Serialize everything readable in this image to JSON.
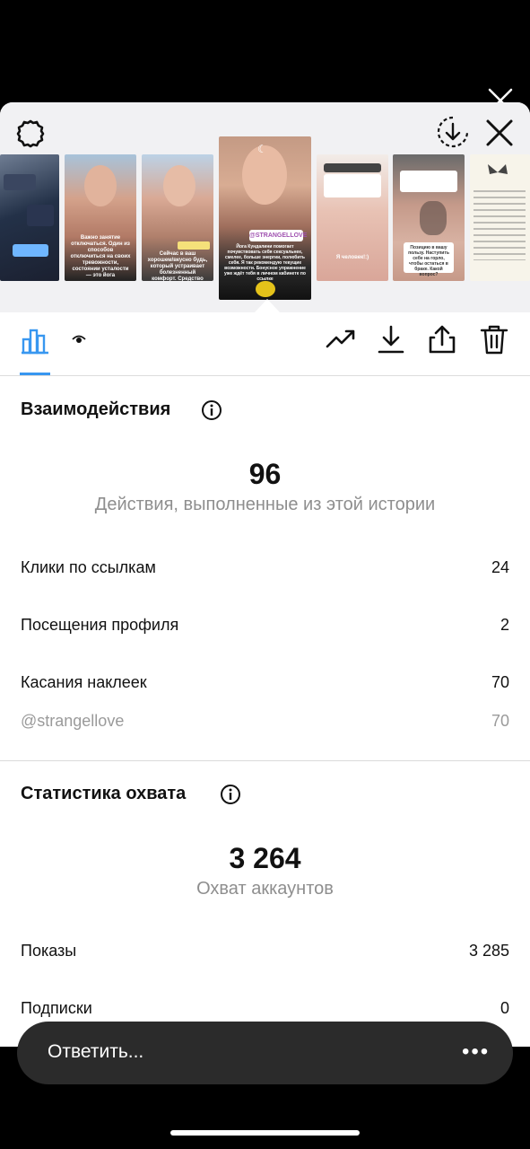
{
  "toolbar": {
    "tabs": [
      {
        "icon": "bar-chart-icon",
        "active": true
      },
      {
        "icon": "eye-icon",
        "active": false
      }
    ],
    "actions": [
      "trending-icon",
      "download-icon",
      "share-icon",
      "trash-icon"
    ],
    "accent": "#3897f0"
  },
  "stories_strip": {
    "thumbs": [
      {
        "caption": ""
      },
      {
        "caption": "Важно занятие отключаться. Один из способов отключиться на своих тревожности, состоянии усталости — это йога"
      },
      {
        "caption": "Сейчас в ваш хорошем/вкусно будь, который устраивает болезненный комфорт. Средство кружение для природы. Кроме Я давно болезни"
      },
      {
        "caption": "Йога Кундалини помогает почувствовать себя сексуальнее, смелее, больше энергии, полюбить себя. Я так рекомендую текущие возможности. Бонусное упражнение уже ждёт тебя в личном кабинете по ссылке",
        "sticker": "@STRANGELLOVE",
        "selected": true
      },
      {
        "caption": "Я человек!:)"
      },
      {
        "caption": "Позицию в вашу пользу. Наступить себе на горло, чтобы остаться в браке. Какой вопрос?"
      },
      {
        "caption": ""
      }
    ]
  },
  "interactions": {
    "title": "Взаимодействия",
    "total": "96",
    "total_label": "Действия, выполненные из этой истории",
    "rows": [
      {
        "label": "Клики по ссылкам",
        "value": "24"
      },
      {
        "label": "Посещения профиля",
        "value": "2"
      },
      {
        "label": "Касания наклеек",
        "value": "70"
      }
    ],
    "sub_row": {
      "label": "@strangellove",
      "value": "70"
    }
  },
  "reach": {
    "title": "Статистика охвата",
    "total": "3 264",
    "total_label": "Охват аккаунтов",
    "rows": [
      {
        "label": "Показы",
        "value": "3 285"
      },
      {
        "label": "Подписки",
        "value": "0"
      }
    ]
  },
  "reply_bar": {
    "placeholder": "Ответить...",
    "more": "•••"
  }
}
